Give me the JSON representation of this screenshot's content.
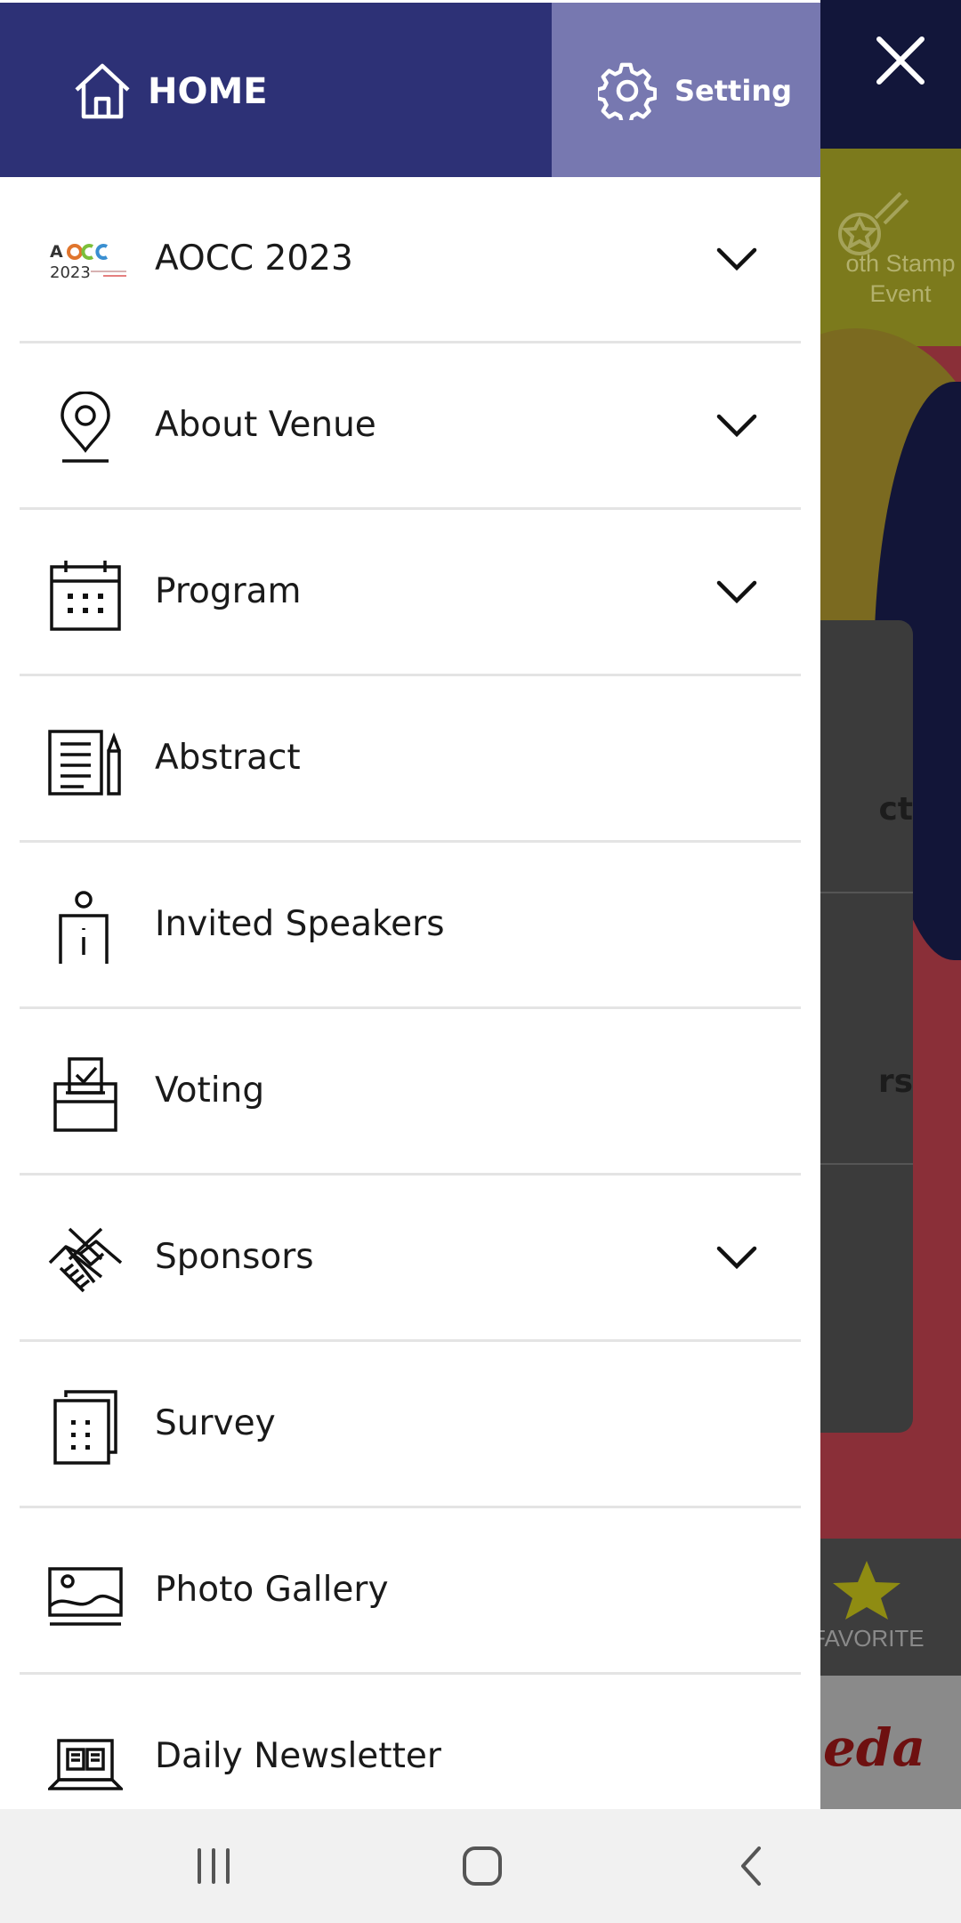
{
  "header": {
    "home_label": "HOME",
    "setting_label": "Setting",
    "home_color": "#2d3176",
    "setting_color": "#7778b0"
  },
  "menu": {
    "items": [
      {
        "label": "AOCC 2023",
        "icon": "aocc-logo",
        "expandable": true
      },
      {
        "label": "About Venue",
        "icon": "location-pin-icon",
        "expandable": true
      },
      {
        "label": "Program",
        "icon": "calendar-icon",
        "expandable": true
      },
      {
        "label": "Abstract",
        "icon": "document-pen-icon",
        "expandable": false
      },
      {
        "label": "Invited Speakers",
        "icon": "speaker-podium-icon",
        "expandable": false
      },
      {
        "label": "Voting",
        "icon": "ballot-box-icon",
        "expandable": false
      },
      {
        "label": "Sponsors",
        "icon": "handshake-icon",
        "expandable": true
      },
      {
        "label": "Survey",
        "icon": "survey-sheet-icon",
        "expandable": false
      },
      {
        "label": "Photo Gallery",
        "icon": "image-icon",
        "expandable": false
      },
      {
        "label": "Daily Newsletter",
        "icon": "newsletter-laptop-icon",
        "expandable": false
      }
    ]
  },
  "logo": {
    "top": "AOCC",
    "bottom": "2023"
  },
  "background": {
    "stamp_label_line1": "oth Stamp",
    "stamp_label_line2": "Event",
    "card_text_1": "ct",
    "card_text_2": "rs",
    "favorite_label": "FAVORITE",
    "banner_text": "eda"
  },
  "colors": {
    "accent_dark": "#2d3176",
    "accent_light": "#7778b0"
  }
}
